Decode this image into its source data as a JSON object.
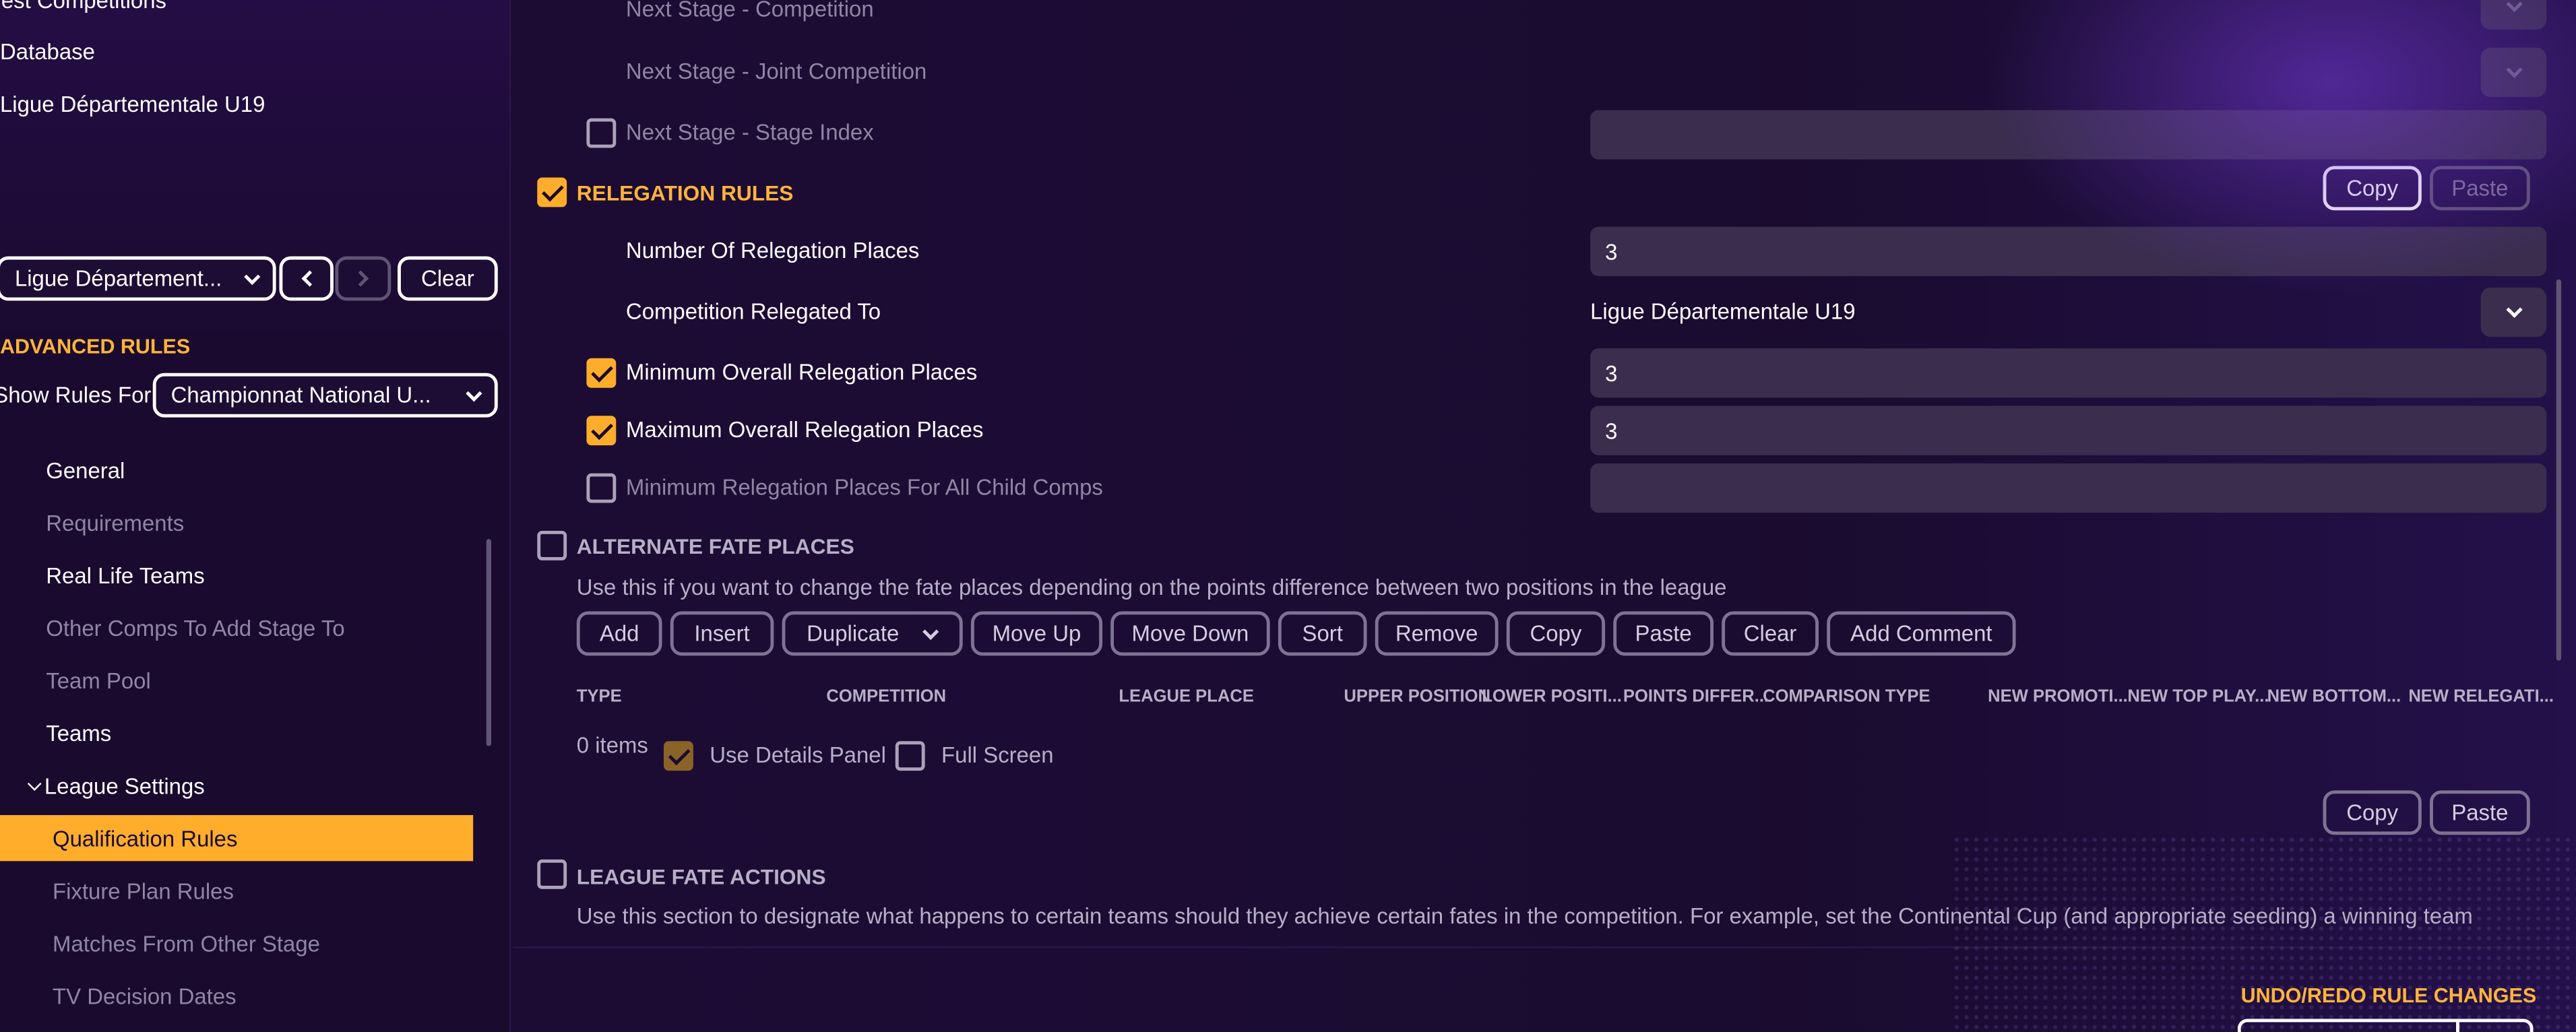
{
  "sidebar": {
    "nav_top": [
      "Test Competitions",
      "Database",
      "Ligue Départementale U19"
    ],
    "competition_select": "Ligue Départementale U19",
    "competition_select_display": "Ligue Département...",
    "clear_label": "Clear",
    "advanced_rules_title": "ADVANCED RULES",
    "show_rules_for_label": "Show Rules For",
    "show_rules_for_value": "Championnat National U...",
    "tree": [
      {
        "label": "General"
      },
      {
        "label": "Requirements"
      },
      {
        "label": "Real Life Teams"
      },
      {
        "label": "Other Comps To Add Stage To"
      },
      {
        "label": "Team Pool"
      },
      {
        "label": "Teams"
      },
      {
        "label": "League Settings"
      },
      {
        "label": "Qualification Rules"
      },
      {
        "label": "Fixture Plan Rules"
      },
      {
        "label": "Matches From Other Stage"
      },
      {
        "label": "TV Decision Dates"
      }
    ]
  },
  "main": {
    "next_stage_competition": "Next Stage - Competition",
    "next_stage_joint_competition": "Next Stage - Joint Competition",
    "next_stage_stage_index": "Next Stage - Stage Index",
    "relegation_rules_title": "RELEGATION RULES",
    "copy_label": "Copy",
    "paste_label": "Paste",
    "number_of_relegation_places_label": "Number Of Relegation Places",
    "number_of_relegation_places_value": "3",
    "competition_relegated_to_label": "Competition Relegated To",
    "competition_relegated_to_value": "Ligue Départementale U19",
    "min_overall_label": "Minimum Overall Relegation Places",
    "min_overall_value": "3",
    "max_overall_label": "Maximum Overall Relegation Places",
    "max_overall_value": "3",
    "min_child_label": "Minimum Relegation Places For All Child Comps",
    "min_child_value": "",
    "alternate_fate_title": "ALTERNATE FATE PLACES",
    "alternate_fate_desc": "Use this if you want to change the fate places depending on the points difference between two positions in the league",
    "toolbar": [
      "Add",
      "Insert",
      "Duplicate",
      "Move Up",
      "Move Down",
      "Sort",
      "Remove",
      "Copy",
      "Paste",
      "Clear",
      "Add Comment"
    ],
    "columns": [
      "TYPE",
      "COMPETITION",
      "LEAGUE PLACE",
      "UPPER POSITION",
      "LOWER POSITI...",
      "POINTS DIFFER...",
      "COMPARISON TYPE",
      "NEW PROMOTI...",
      "NEW TOP PLAY...",
      "NEW BOTTOM...",
      "NEW RELEGATI..."
    ],
    "items_count": "0 items",
    "use_details_panel": "Use Details Panel",
    "full_screen": "Full Screen",
    "league_fate_title": "LEAGUE FATE ACTIONS",
    "league_fate_desc": "Use this section to designate what happens to certain teams should they achieve certain fates in the competition. For example, set the Continental Cup (and appropriate seeding) a winning team",
    "undo_redo": "UNDO/REDO RULE CHANGES"
  },
  "colors": {
    "accent": "#ffad2b",
    "background": "#1b0a30",
    "field": "#3a2d4e"
  }
}
